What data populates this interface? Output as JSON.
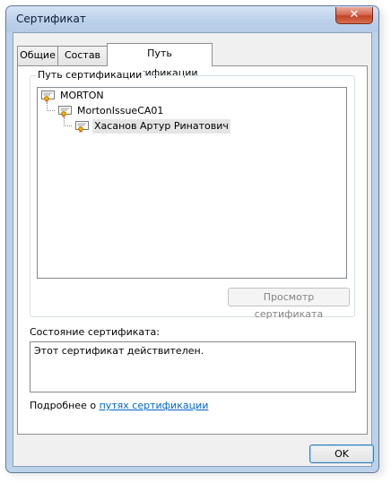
{
  "window": {
    "title": "Сертификат",
    "close_label": "✕"
  },
  "tabs": [
    {
      "label": "Общие"
    },
    {
      "label": "Состав"
    },
    {
      "label": "Путь сертификации",
      "active": true
    }
  ],
  "path_group": {
    "label": "Путь сертификации",
    "nodes": [
      {
        "label": "MORTON"
      },
      {
        "label": "MortonIssueCA01"
      },
      {
        "label": "Хасанов Артур Ринатович",
        "selected": true
      }
    ],
    "view_button": "Просмотр сертификата"
  },
  "status": {
    "label": "Состояние сертификата:",
    "text": "Этот сертификат действителен."
  },
  "more_info": {
    "prefix": "Подробнее о ",
    "link": "путях сертификации"
  },
  "ok_button": "OK",
  "icons": {
    "node": "certificate-icon",
    "close": "close-icon"
  }
}
